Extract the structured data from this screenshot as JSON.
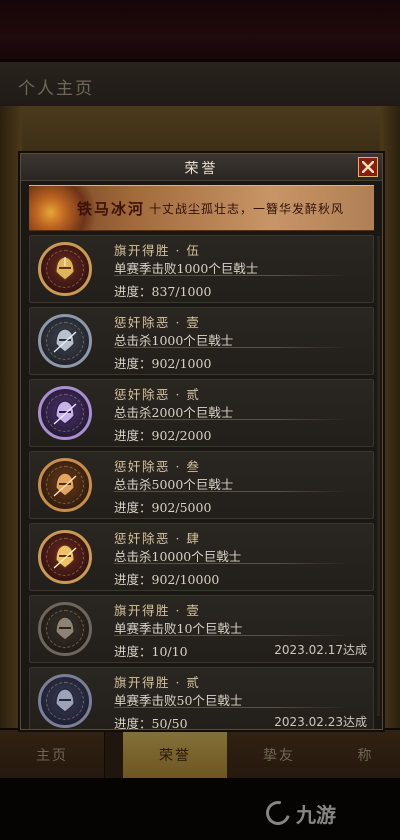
{
  "background": {
    "page_title": "个人主页",
    "tabs": [
      {
        "label": "主页",
        "active": false
      },
      {
        "label": "荣誉",
        "active": true
      },
      {
        "label": "挚友",
        "active": false
      },
      {
        "label": "称",
        "active": false
      }
    ]
  },
  "watermark": {
    "text": "九游"
  },
  "dialog": {
    "title": "荣誉",
    "banner": {
      "name": "铁马冰河",
      "verse": "十丈战尘孤壮志，一簪华发醉秋风"
    },
    "progress_prefix": "进度：",
    "achievements": [
      {
        "title": "旗开得胜 · 伍",
        "desc": "单赛季击败1000个巨戟士",
        "progress": "837/1000",
        "date": "",
        "medal": "gold"
      },
      {
        "title": "惩奸除恶 · 壹",
        "desc": "总击杀1000个巨戟士",
        "progress": "902/1000",
        "date": "",
        "medal": "silver"
      },
      {
        "title": "惩奸除恶 · 贰",
        "desc": "总击杀2000个巨戟士",
        "progress": "902/2000",
        "date": "",
        "medal": "purple"
      },
      {
        "title": "惩奸除恶 · 叁",
        "desc": "总击杀5000个巨戟士",
        "progress": "902/5000",
        "date": "",
        "medal": "bronze"
      },
      {
        "title": "惩奸除恶 · 肆",
        "desc": "总击杀10000个巨戟士",
        "progress": "902/10000",
        "date": "",
        "medal": "gold"
      },
      {
        "title": "旗开得胜 · 壹",
        "desc": "单赛季击败10个巨戟士",
        "progress": "10/10",
        "date": "2023.02.17达成",
        "medal": "grey"
      },
      {
        "title": "旗开得胜 · 贰",
        "desc": "单赛季击败50个巨戟士",
        "progress": "50/50",
        "date": "2023.02.23达成",
        "medal": "steel"
      }
    ]
  }
}
